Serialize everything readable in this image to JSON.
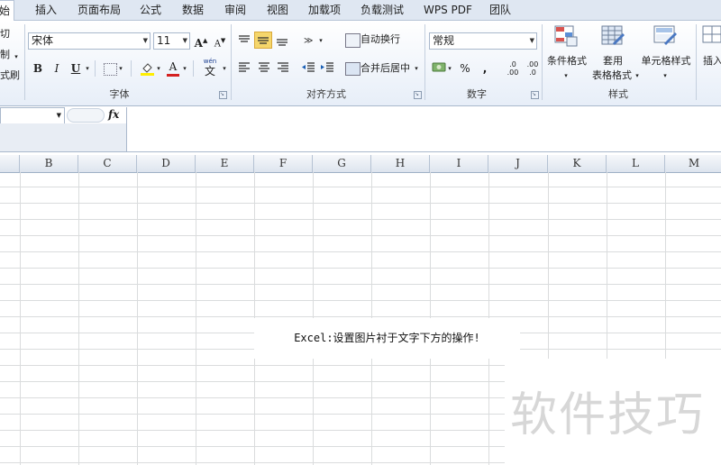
{
  "ribbon_tabs": [
    "始",
    "插入",
    "页面布局",
    "公式",
    "数据",
    "审阅",
    "视图",
    "加载项",
    "负载测试",
    "WPS PDF",
    "团队"
  ],
  "clipboard": {
    "cut": "切",
    "copy": "制",
    "format_painter": "式刷"
  },
  "font": {
    "name": "宋体",
    "size": "11",
    "bold": "B",
    "italic": "I",
    "underline": "U",
    "grow": "A",
    "shrink": "A",
    "font_color": "A",
    "wen": "wén",
    "wen_char": "文",
    "group_label": "字体"
  },
  "alignment": {
    "wrap_text": "自动换行",
    "merge_center": "合并后居中",
    "group_label": "对齐方式"
  },
  "number": {
    "format": "常规",
    "percent": "%",
    "comma": ",",
    "inc_decimal": "←.0\n.00",
    "dec_decimal": ".00\n→.0",
    "inc_a": ".0",
    "inc_b": ".00",
    "dec_a": ".00",
    "dec_b": ".0",
    "group_label": "数字"
  },
  "styles": {
    "conditional": "条件格式",
    "table_a": "套用",
    "table_b": "表格格式",
    "cell_styles": "单元格样式",
    "group_label": "样式"
  },
  "cells": {
    "insert": "插入"
  },
  "formula_bar": {
    "fx": "fx"
  },
  "columns": [
    "B",
    "C",
    "D",
    "E",
    "F",
    "G",
    "H",
    "I",
    "J",
    "K",
    "L",
    "M"
  ],
  "caption": "Excel:设置图片衬于文字下方的操作!",
  "watermark": "软件技巧",
  "colors": {
    "tab_bar": "#dfe7f2",
    "accent_yellow": "#f5d66b",
    "font_red": "#d42020",
    "fill_yellow": "#ffee00",
    "grid": "#dadcdd"
  }
}
